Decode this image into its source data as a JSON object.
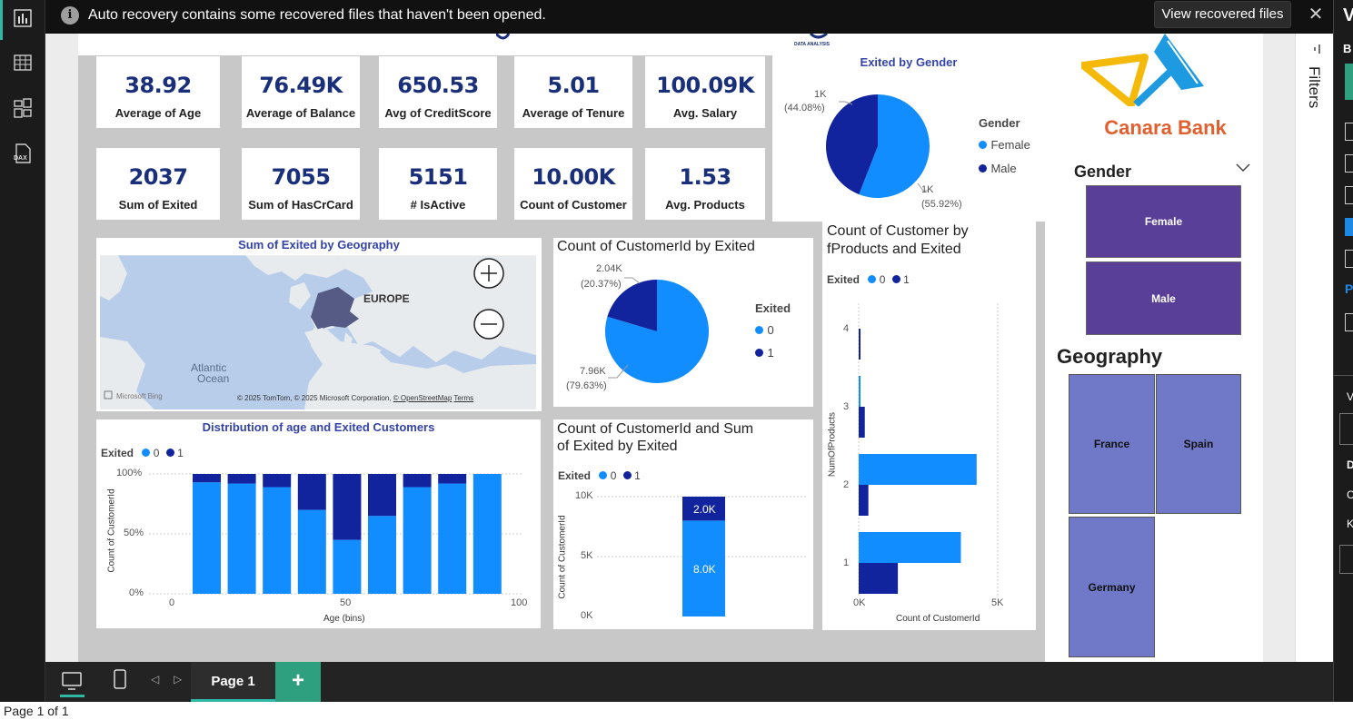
{
  "notification": {
    "message": "Auto recovery contains some recovered files that haven't been opened.",
    "button": "View recovered files",
    "info_icon": "i"
  },
  "kpis_row1": [
    {
      "value": "38.92",
      "label": "Average of Age"
    },
    {
      "value": "76.49K",
      "label": "Average of Balance"
    },
    {
      "value": "650.53",
      "label": "Avg of CreditScore"
    },
    {
      "value": "5.01",
      "label": "Average of Tenure"
    },
    {
      "value": "100.09K",
      "label": "Avg. Salary"
    }
  ],
  "kpis_row2": [
    {
      "value": "2037",
      "label": "Sum of Exited"
    },
    {
      "value": "7055",
      "label": "Sum of HasCrCard"
    },
    {
      "value": "5151",
      "label": "# IsActive"
    },
    {
      "value": "10.00K",
      "label": "Count of Customer"
    },
    {
      "value": "1.53",
      "label": "Avg. Products"
    }
  ],
  "logo_small_text": "DATA ANALYSIS",
  "gender_pie": {
    "title": "Exited by Gender",
    "legend_title": "Gender",
    "legend": [
      "Female",
      "Male"
    ],
    "label_top": "1K",
    "label_top_pct": "(44.08%)",
    "label_bottom": "1K",
    "label_bottom_pct": "(55.92%)"
  },
  "brand": {
    "name": "Canara Bank"
  },
  "gender_slicer": {
    "title": "Gender",
    "items": [
      "Female",
      "Male"
    ]
  },
  "geo_slicer": {
    "title": "Geography",
    "items": [
      "France",
      "Spain",
      "Germany"
    ]
  },
  "map": {
    "title": "Sum of Exited by Geography",
    "region_label": "EUROPE",
    "ocean_label_1": "Atlantic",
    "ocean_label_2": "Ocean",
    "bing": "Microsoft Bing",
    "attribution": "© 2025 TomTom, © 2025 Microsoft Corporation,",
    "osm": "© OpenStreetMap",
    "terms": "Terms"
  },
  "exited_pie": {
    "title": "Count of CustomerId by Exited",
    "legend_title": "Exited",
    "legend": [
      "0",
      "1"
    ],
    "label_top": "2.04K",
    "label_top_pct": "(20.37%)",
    "label_bottom": "7.96K",
    "label_bottom_pct": "(79.63%)"
  },
  "age_chart": {
    "title": "Distribution of age and Exited Customers",
    "legend_title": "Exited",
    "legend": [
      "0",
      "1"
    ],
    "ylabel": "Count of CustomerId",
    "xlabel": "Age (bins)",
    "yticks": [
      "100%",
      "50%",
      "0%"
    ],
    "xticks": [
      "0",
      "50",
      "100"
    ]
  },
  "stack_chart": {
    "title_line1": "Count of CustomerId and Sum",
    "title_line2": "of Exited by Exited",
    "legend_title": "Exited",
    "legend": [
      "0",
      "1"
    ],
    "ylabel": "Count of CustomerId",
    "yticks": [
      "10K",
      "5K",
      "0K"
    ],
    "label_top": "2.0K",
    "label_bottom": "8.0K"
  },
  "products_chart": {
    "title_line1": "Count of Customer by",
    "title_line2": "fProducts and Exited",
    "legend_title": "Exited",
    "legend": [
      "0",
      "1"
    ],
    "ylabel": "NumOfProducts",
    "xlabel": "Count of CustomerId",
    "yticks": [
      "4",
      "3",
      "2",
      "1"
    ],
    "xticks": [
      "0K",
      "5K"
    ]
  },
  "filters_label": "Filters",
  "page_tab": "Page 1",
  "status": "Page 1 of 1",
  "colors": {
    "exited0": "#118dff",
    "exited1": "#12239e",
    "slicer": "#5a3f99",
    "geo": "#6f79c7",
    "brand": "#e06030"
  },
  "chart_data": [
    {
      "type": "pie",
      "title": "Exited by Gender",
      "categories": [
        "Female",
        "Male"
      ],
      "values": [
        55.92,
        44.08
      ]
    },
    {
      "type": "pie",
      "title": "Count of CustomerId by Exited",
      "categories": [
        "0",
        "1"
      ],
      "values": [
        7960,
        2040
      ]
    },
    {
      "type": "bar",
      "title": "Distribution of age and Exited Customers",
      "xlabel": "Age (bins)",
      "ylabel": "Count of CustomerId",
      "ylim": [
        0,
        100
      ],
      "x": [
        10,
        20,
        30,
        40,
        50,
        60,
        70,
        80,
        90
      ],
      "series": [
        {
          "name": "0",
          "values": [
            93,
            92,
            89,
            70,
            45,
            65,
            89,
            92,
            100
          ]
        },
        {
          "name": "1",
          "values": [
            7,
            8,
            11,
            30,
            55,
            35,
            11,
            8,
            0
          ]
        }
      ]
    },
    {
      "type": "bar",
      "title": "Count of CustomerId and Sum of Exited by Exited",
      "ylabel": "Count of CustomerId",
      "ylim": [
        0,
        10000
      ],
      "series": [
        {
          "name": "0",
          "values": [
            8000
          ]
        },
        {
          "name": "1",
          "values": [
            2000
          ]
        }
      ]
    },
    {
      "type": "bar",
      "title": "Count of Customer by fProducts and Exited",
      "xlabel": "Count of CustomerId",
      "ylabel": "NumOfProducts",
      "categories": [
        "1",
        "2",
        "3",
        "4"
      ],
      "series": [
        {
          "name": "0",
          "values": [
            3675,
            4242,
            46,
            0
          ]
        },
        {
          "name": "1",
          "values": [
            1409,
            348,
            220,
            60
          ]
        }
      ]
    }
  ]
}
